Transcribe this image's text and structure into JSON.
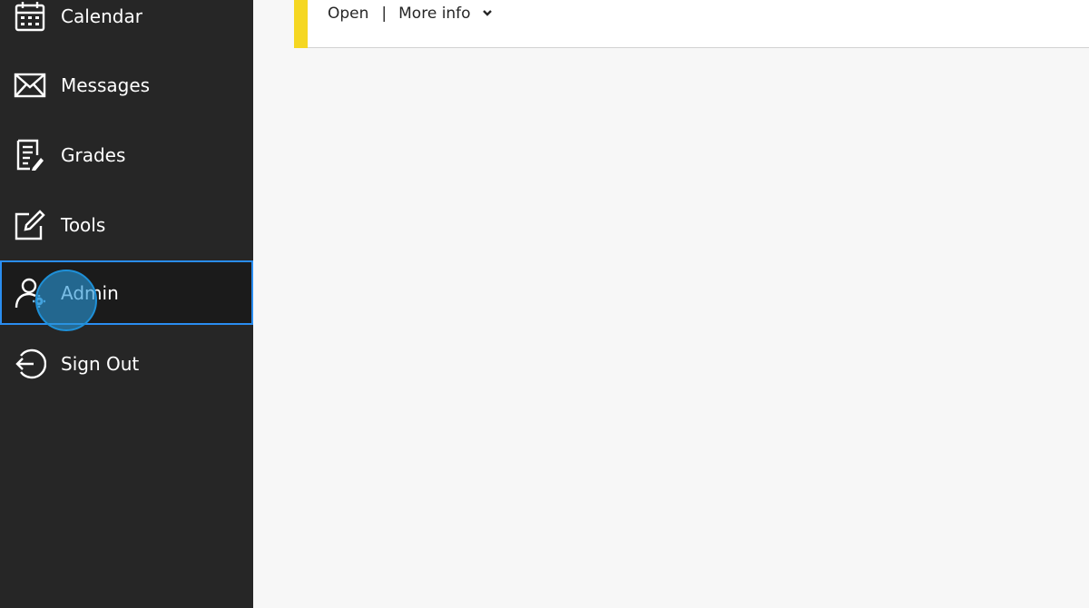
{
  "sidebar": {
    "items": [
      {
        "label": "Calendar",
        "icon": "calendar-icon"
      },
      {
        "label": "Messages",
        "icon": "envelope-icon"
      },
      {
        "label": "Grades",
        "icon": "grades-icon"
      },
      {
        "label": "Tools",
        "icon": "edit-icon"
      },
      {
        "label": "Admin",
        "icon": "user-gear-icon",
        "active": true
      },
      {
        "label": "Sign Out",
        "icon": "sign-out-icon"
      }
    ]
  },
  "card": {
    "open_label": "Open",
    "separator": "|",
    "more_info_label": "More info",
    "more_info_icon": "chevron-down-icon",
    "accent_color": "#f5d722"
  },
  "colors": {
    "sidebar_bg": "#262626",
    "active_border": "#2a8df0",
    "main_bg": "#f7f7f7"
  }
}
